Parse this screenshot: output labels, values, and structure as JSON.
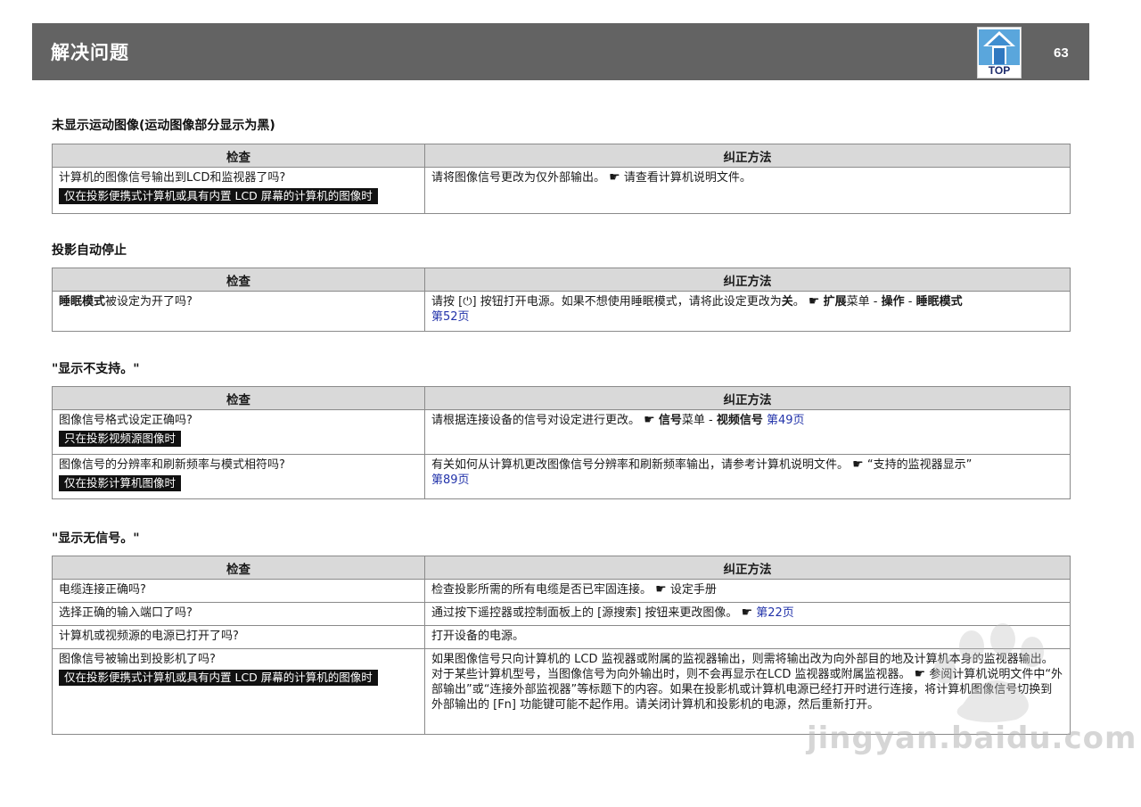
{
  "header": {
    "title": "解决问题",
    "top_label": "TOP",
    "page_number": "63"
  },
  "columns": {
    "check": "检查",
    "fix": "纠正方法"
  },
  "sections": [
    {
      "title": "未显示运动图像(运动图像部分显示为黑)",
      "rows": [
        {
          "check": "计算机的图像信号输出到LCD和监视器了吗?",
          "tag": "仅在投影便携式计算机或具有内置 LCD 屏幕的计算机的图像时",
          "fix_a": "请将图像信号更改为仅外部输出。",
          "fix_b": "请查看计算机说明文件。"
        }
      ]
    },
    {
      "title": "投影自动停止",
      "rows": [
        {
          "check_bold": "睡眠模式",
          "check_rest": "被设定为开了吗?",
          "fix_a": "请按 [",
          "power_symbol": "⏻",
          "fix_b": "] 按钮打开电源。如果不想使用睡眠模式，请将此设定更改为",
          "fix_off": "关",
          "fix_c": "。",
          "menu1": "扩展",
          "menu_word": "菜单 - ",
          "menu2": "操作",
          "menu3": "睡眠模式",
          "link": "第52页"
        }
      ]
    },
    {
      "title": "\"显示不支持。\"",
      "rows": [
        {
          "check": "图像信号格式设定正确吗?",
          "tag": "只在投影视频源图像时",
          "fix_a": "请根据连接设备的信号对设定进行更改。",
          "menu1": "信号",
          "menu_word": "菜单 - ",
          "menu2": "视频信号",
          "link": "第49页"
        },
        {
          "check": "图像信号的分辨率和刷新频率与模式相符吗?",
          "tag": "仅在投影计算机图像时",
          "fix_a": "有关如何从计算机更改图像信号分辨率和刷新频率输出，请参考计算机说明文件。",
          "fix_b": "“支持的监视器显示”",
          "link": "第89页"
        }
      ]
    },
    {
      "title": "\"显示无信号。\"",
      "rows": [
        {
          "check": "电缆连接正确吗?",
          "fix_a": "检查投影所需的所有电缆是否已牢固连接。",
          "fix_b": "设定手册"
        },
        {
          "check": "选择正确的输入端口了吗?",
          "fix_a": "通过按下遥控器或控制面板上的 [源搜索] 按钮来更改图像。",
          "link": "第22页"
        },
        {
          "check": "计算机或视频源的电源已打开了吗?",
          "fix_a": "打开设备的电源。"
        },
        {
          "check": "图像信号被输出到投影机了吗?",
          "tag": "仅在投影便携式计算机或具有内置 LCD 屏幕的计算机的图像时",
          "fix_a": "如果图像信号只向计算机的 LCD 监视器或附属的监视器输出，则需将输出改为向外部目的地及计算机本身的监视器输出。对于某些计算机型号，当图像信号为向外输出时，则不会再显示在LCD 监视器或附属监视器。",
          "fix_b": "参阅计算机说明文件中“外部输出”或“连接外部监视器”等标题下的内容。如果在投影机或计算机电源已经打开时进行连接，将计算机图像信号切换到外部输出的 [Fn] 功能键可能不起作用。请关闭计算机和投影机的电源，然后重新打开。"
        }
      ]
    }
  ],
  "pointer_glyph": "☛",
  "watermark": "jingyan.baidu.com"
}
